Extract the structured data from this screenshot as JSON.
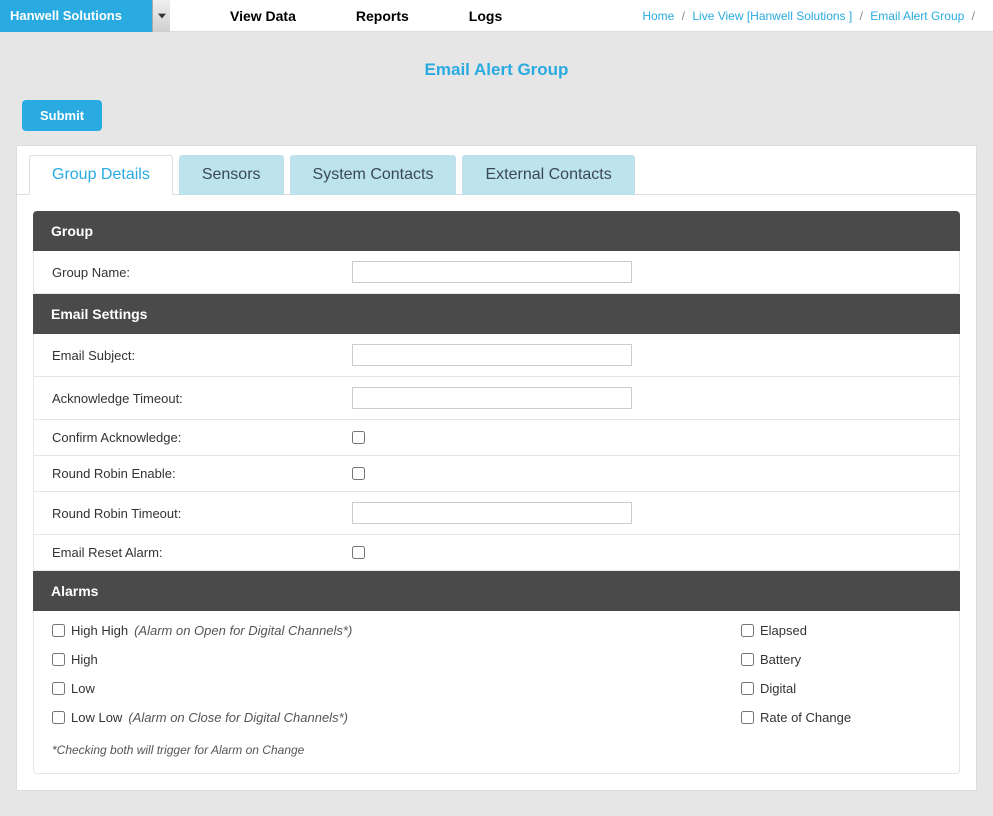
{
  "brand": "Hanwell Solutions",
  "nav": {
    "view_data": "View Data",
    "reports": "Reports",
    "logs": "Logs"
  },
  "breadcrumb": {
    "home": "Home",
    "live_view": "Live View [Hanwell Solutions ]",
    "current": "Email Alert Group"
  },
  "page_title": "Email Alert Group",
  "submit_label": "Submit",
  "tabs": {
    "group_details": "Group Details",
    "sensors": "Sensors",
    "system_contacts": "System Contacts",
    "external_contacts": "External Contacts"
  },
  "sections": {
    "group": {
      "header": "Group",
      "group_name_label": "Group Name:",
      "group_name_value": ""
    },
    "email_settings": {
      "header": "Email Settings",
      "email_subject_label": "Email Subject:",
      "email_subject_value": "",
      "ack_timeout_label": "Acknowledge Timeout:",
      "ack_timeout_value": "",
      "confirm_ack_label": "Confirm Acknowledge:",
      "round_robin_enable_label": "Round Robin Enable:",
      "round_robin_timeout_label": "Round Robin Timeout:",
      "round_robin_timeout_value": "",
      "email_reset_alarm_label": "Email Reset Alarm:"
    },
    "alarms": {
      "header": "Alarms",
      "high_high_label": "High High",
      "high_high_hint": "(Alarm on Open for Digital Channels*)",
      "high_label": "High",
      "low_label": "Low",
      "low_low_label": "Low Low",
      "low_low_hint": "(Alarm on Close for Digital Channels*)",
      "elapsed_label": "Elapsed",
      "battery_label": "Battery",
      "digital_label": "Digital",
      "rate_label": "Rate of Change",
      "note": "*Checking both will trigger for Alarm on Change"
    }
  }
}
